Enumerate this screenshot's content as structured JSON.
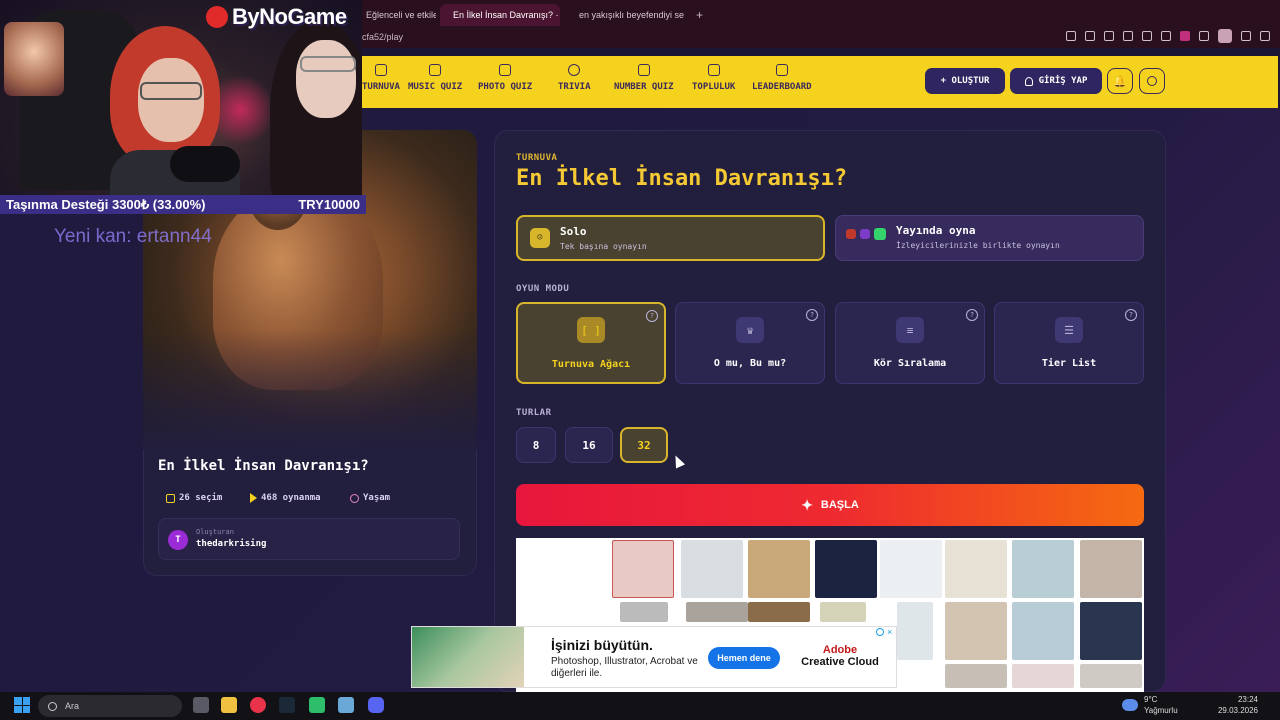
{
  "browser": {
    "tabs": [
      {
        "label": "Eğlenceli ve etkile"
      },
      {
        "label": "En İlkel İnsan Davranışı? ·"
      },
      {
        "label": "en yakışıklı beyefendiyi se"
      }
    ],
    "url": "cfa52/play"
  },
  "nav": {
    "items": [
      {
        "label": "TURNUVA",
        "icon": "trophy-icon"
      },
      {
        "label": "MUSIC QUIZ",
        "icon": "music-icon"
      },
      {
        "label": "PHOTO QUIZ",
        "icon": "camera-icon"
      },
      {
        "label": "TRIVIA",
        "icon": "question-icon"
      },
      {
        "label": "NUMBER QUIZ",
        "icon": "hash-icon"
      },
      {
        "label": "TOPLULUK",
        "icon": "users-icon"
      },
      {
        "label": "LEADERBOARD",
        "icon": "award-icon"
      }
    ],
    "create_label": "+ OLUŞTUR",
    "login_label": "GİRİŞ YAP"
  },
  "card": {
    "title": "En İlkel İnsan Davranışı?",
    "choices": "26 seçim",
    "plays": "468 oynanma",
    "category": "Yaşam",
    "creator_label": "Oluşturan",
    "creator_name": "thedarkrising",
    "creator_initial": "T"
  },
  "panel": {
    "eyebrow": "TURNUVA",
    "title": "En İlkel İnsan Davranışı?",
    "solo_title": "Solo",
    "solo_sub": "Tek başına oynayın",
    "live_title": "Yayında oyna",
    "live_sub": "İzleyicilerinizle birlikte oynayın",
    "mode_label": "OYUN MODU",
    "modes": [
      {
        "label": "Turnuva Ağacı",
        "icon": "bracket-icon",
        "selected": true
      },
      {
        "label": "O mu, Bu mu?",
        "icon": "crown-icon",
        "selected": false
      },
      {
        "label": "Kör Sıralama",
        "icon": "list-ordered-icon",
        "selected": false
      },
      {
        "label": "Tier List",
        "icon": "list-icon",
        "selected": false
      }
    ],
    "rounds_label": "TURLAR",
    "rounds": [
      "8",
      "16",
      "32"
    ],
    "selected_round": "32",
    "start_label": "BAŞLA"
  },
  "ad": {
    "headline": "İşinizi büyütün.",
    "body": "Photoshop, Illustrator, Acrobat ve diğerleri ile.",
    "cta": "Hemen dene",
    "brand_line1": "Adobe",
    "brand_line2": "Creative Cloud"
  },
  "stream": {
    "brand": "ByNoGame",
    "goal_label": "Taşınma Desteği 3300₺ (33.00%)",
    "goal_target": "TRY10000",
    "goal_progress": 0.33,
    "new_sub": "Yeni kan: ertann44"
  },
  "taskbar": {
    "search_placeholder": "Ara",
    "weather_temp": "9°C",
    "weather_desc": "Yağmurlu",
    "time": "23:24",
    "date": "29.03.2026"
  },
  "colors": {
    "nav_yellow": "#f5d21e",
    "accent_gold": "#f5c933",
    "start_red": "#e8163c",
    "start_orange": "#f56a10",
    "card_bg": "#221e3e"
  }
}
